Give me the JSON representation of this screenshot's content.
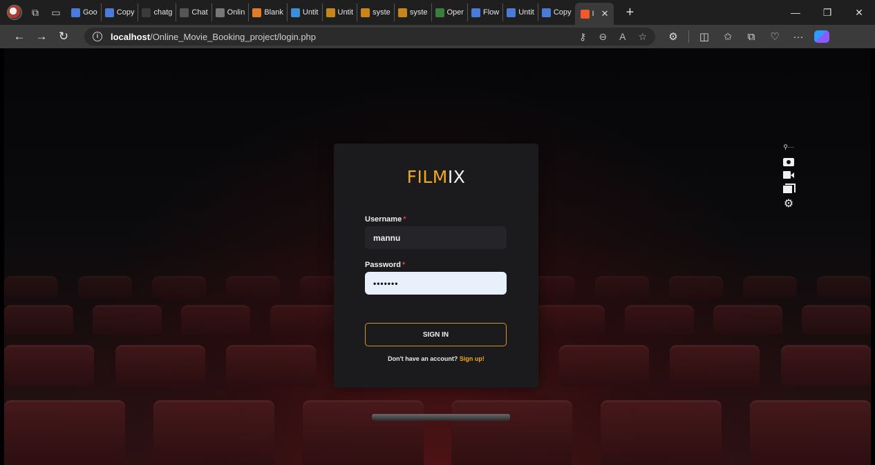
{
  "browser": {
    "tabs": [
      {
        "label": "Goo",
        "color": "#4a7bd8"
      },
      {
        "label": "Copy",
        "color": "#4a7bd8"
      },
      {
        "label": "chatg",
        "color": "#3a3a3a"
      },
      {
        "label": "Chat",
        "color": "#555555"
      },
      {
        "label": "Onlin",
        "color": "#777777"
      },
      {
        "label": "Blank",
        "color": "#e07b2a"
      },
      {
        "label": "Untit",
        "color": "#3b8ed8"
      },
      {
        "label": "Untit",
        "color": "#c7861a"
      },
      {
        "label": "syste",
        "color": "#c7861a"
      },
      {
        "label": "syste",
        "color": "#c7861a"
      },
      {
        "label": "Oper",
        "color": "#3b7d3b"
      },
      {
        "label": "Flow",
        "color": "#4a7bd8"
      },
      {
        "label": "Untit",
        "color": "#4a7bd8"
      },
      {
        "label": "Copy",
        "color": "#4a7bd8"
      }
    ],
    "active_tab": {
      "label": "I",
      "color": "#f05a28"
    },
    "url_host": "localhost",
    "url_path": "/Online_Movie_Booking_project/login.php"
  },
  "login": {
    "brand_accent": "FILM",
    "brand_rest": "IX",
    "username_label": "Username",
    "password_label": "Password",
    "required_mark": "*",
    "username_value": "mannu",
    "password_value": "•••••••",
    "signin_label": "SIGN IN",
    "signup_prompt": "Don't have an account?",
    "signup_link": "Sign up!"
  },
  "colors": {
    "accent": "#f2a91c",
    "required": "#e23b3b",
    "card": "#1b1b1d"
  }
}
